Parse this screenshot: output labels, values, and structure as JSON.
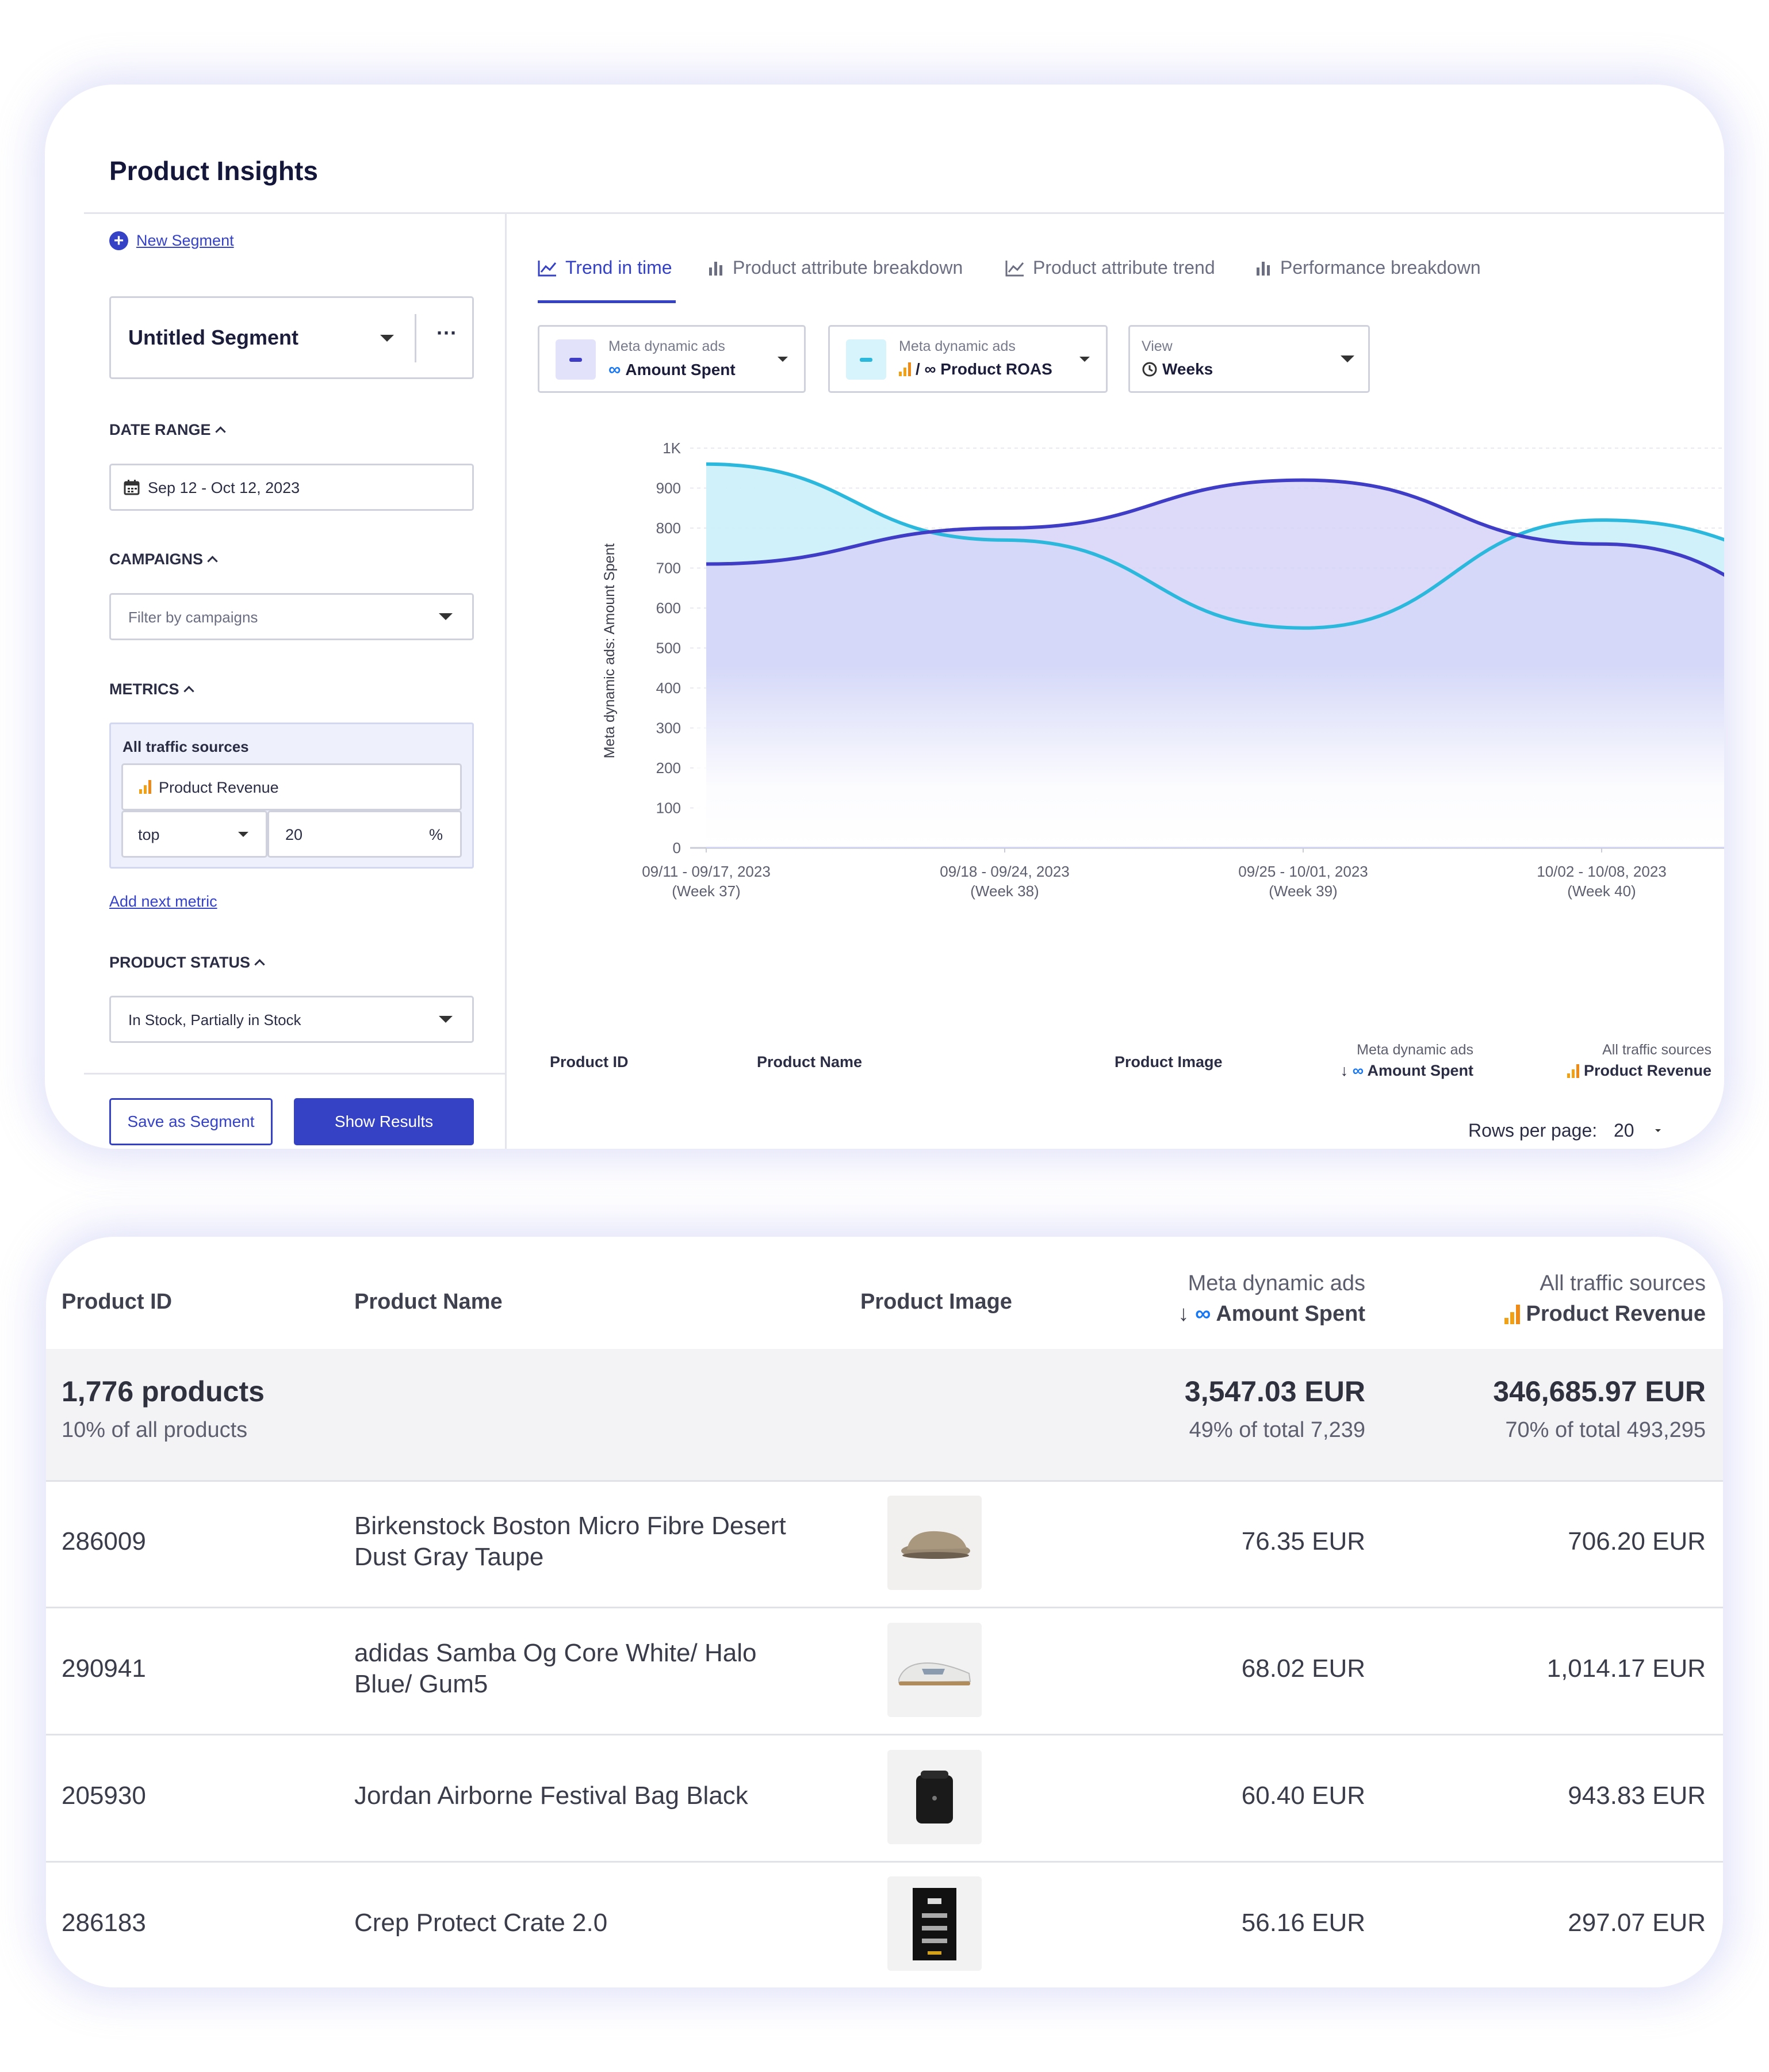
{
  "insights": {
    "title": "Product Insights",
    "new_segment": "New Segment",
    "segment_name": "Untitled Segment",
    "more_label": "···",
    "date_range": {
      "label": "DATE RANGE",
      "value": "Sep 12 - Oct 12, 2023"
    },
    "campaigns": {
      "label": "CAMPAIGNS",
      "placeholder": "Filter by campaigns"
    },
    "metrics": {
      "label": "METRICS",
      "source": "All traffic sources",
      "metric": "Product Revenue",
      "mode": "top",
      "amount": "20",
      "unit": "%",
      "add_next": "Add next metric"
    },
    "product_status": {
      "label": "PRODUCT STATUS",
      "value": "In Stock, Partially in Stock"
    },
    "save_button": "Save as Segment",
    "show_button": "Show Results",
    "tabs": [
      "Trend in time",
      "Product attribute breakdown",
      "Product attribute trend",
      "Performance breakdown"
    ],
    "selectors": [
      {
        "label": "Meta dynamic ads",
        "value": "Amount Spent"
      },
      {
        "label": "Meta dynamic ads",
        "value": "/ ∞ Product ROAS"
      },
      {
        "label": "View",
        "value": "Weeks"
      }
    ],
    "mini_table": {
      "col_id": "Product ID",
      "col_name": "Product Name",
      "col_image": "Product Image",
      "col_spent_src": "Meta dynamic ads",
      "col_spent": "Amount Spent",
      "col_rev_src": "All traffic sources",
      "col_rev": "Product Revenue"
    },
    "rows_per_page_label": "Rows per page:",
    "rows_per_page_value": "20"
  },
  "chart_data": {
    "type": "area",
    "ylabel": "Meta dynamic ads: Amount Spent",
    "yticks": [
      "0",
      "100",
      "200",
      "300",
      "400",
      "500",
      "600",
      "700",
      "800",
      "900",
      "1K"
    ],
    "ylim": [
      0,
      1000
    ],
    "categories": [
      [
        "09/11 - 09/17, 2023",
        "(Week 37)"
      ],
      [
        "09/18 - 09/24, 2023",
        "(Week 38)"
      ],
      [
        "09/25 - 10/01, 2023",
        "(Week 39)"
      ],
      [
        "10/02 - 10/08, 2023",
        "(Week 40)"
      ]
    ],
    "series": [
      {
        "values": [
          960,
          770,
          550,
          820,
          670
        ],
        "color": "#2cb8dd",
        "fill": "#cdeffa"
      },
      {
        "values": [
          710,
          800,
          920,
          760,
          525
        ],
        "color": "#3f3cc5",
        "fill": "#d6d3f7"
      }
    ],
    "grid": true
  },
  "table": {
    "headers": {
      "id": "Product ID",
      "name": "Product Name",
      "image": "Product Image",
      "spent_src": "Meta dynamic ads",
      "spent": "Amount Spent",
      "rev_src": "All traffic sources",
      "rev": "Product Revenue"
    },
    "summary": {
      "count": "1,776 products",
      "share": "10% of all products",
      "spent": "3,547.03 EUR",
      "spent_share": "49% of total 7,239",
      "revenue": "346,685.97 EUR",
      "revenue_share": "70% of total 493,295"
    },
    "rows": [
      {
        "id": "286009",
        "name_1": "Birkenstock Boston Micro Fibre Desert",
        "name_2": "Dust Gray Taupe",
        "spent": "76.35 EUR",
        "revenue": "706.20 EUR"
      },
      {
        "id": "290941",
        "name_1": "adidas Samba Og Core White/ Halo",
        "name_2": "Blue/ Gum5",
        "spent": "68.02 EUR",
        "revenue": "1,014.17 EUR"
      },
      {
        "id": "205930",
        "name_1": "Jordan Airborne Festival Bag Black",
        "name_2": "",
        "spent": "60.40 EUR",
        "revenue": "943.83 EUR"
      },
      {
        "id": "286183",
        "name_1": "Crep Protect Crate 2.0",
        "name_2": "",
        "spent": "56.16 EUR",
        "revenue": "297.07 EUR"
      }
    ]
  },
  "colors": {
    "accent": "#3542c6",
    "series_cyan": "#2cb8dd",
    "series_indigo": "#3f3cc5",
    "bars_orange": "#f0a116"
  }
}
